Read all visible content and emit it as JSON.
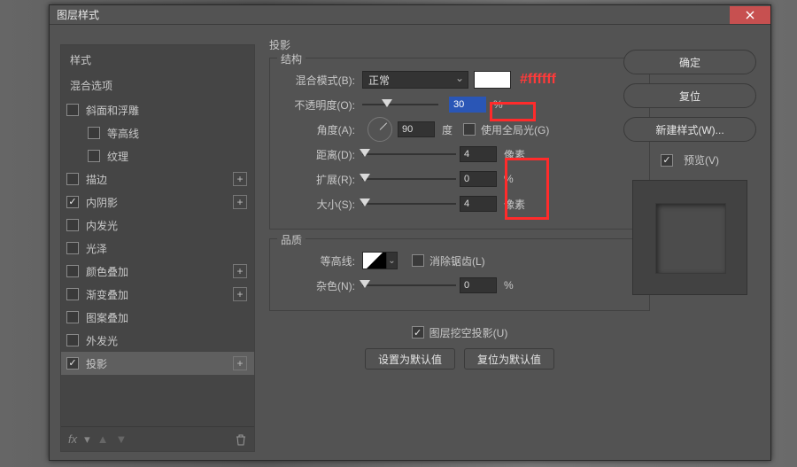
{
  "window": {
    "title": "图层样式"
  },
  "left": {
    "header": "样式",
    "subheader": "混合选项",
    "items": [
      {
        "label": "斜面和浮雕",
        "checked": false,
        "hasPlus": false,
        "indent": false
      },
      {
        "label": "等高线",
        "checked": false,
        "hasPlus": false,
        "indent": true
      },
      {
        "label": "纹理",
        "checked": false,
        "hasPlus": false,
        "indent": true
      },
      {
        "label": "描边",
        "checked": false,
        "hasPlus": true,
        "indent": false
      },
      {
        "label": "内阴影",
        "checked": true,
        "hasPlus": true,
        "indent": false
      },
      {
        "label": "内发光",
        "checked": false,
        "hasPlus": false,
        "indent": false
      },
      {
        "label": "光泽",
        "checked": false,
        "hasPlus": false,
        "indent": false
      },
      {
        "label": "颜色叠加",
        "checked": false,
        "hasPlus": true,
        "indent": false
      },
      {
        "label": "渐变叠加",
        "checked": false,
        "hasPlus": true,
        "indent": false
      },
      {
        "label": "图案叠加",
        "checked": false,
        "hasPlus": false,
        "indent": false
      },
      {
        "label": "外发光",
        "checked": false,
        "hasPlus": false,
        "indent": false
      },
      {
        "label": "投影",
        "checked": true,
        "hasPlus": true,
        "indent": false,
        "selected": true
      }
    ],
    "footer_fx": "fx"
  },
  "mid": {
    "section": "投影",
    "group_structure": "结构",
    "blend_label": "混合模式(B):",
    "blend_value": "正常",
    "annot_color": "#ffffff",
    "opacity_label": "不透明度(O):",
    "opacity_value": "30",
    "opacity_unit": "%",
    "angle_label": "角度(A):",
    "angle_value": "90",
    "angle_unit": "度",
    "global_light_label": "使用全局光(G)",
    "global_light_checked": false,
    "distance_label": "距离(D):",
    "distance_value": "4",
    "distance_unit": "像素",
    "spread_label": "扩展(R):",
    "spread_value": "0",
    "spread_unit": "%",
    "size_label": "大小(S):",
    "size_value": "4",
    "size_unit": "像素",
    "group_quality": "品质",
    "contour_label": "等高线:",
    "antialias_label": "消除锯齿(L)",
    "antialias_checked": false,
    "noise_label": "杂色(N):",
    "noise_value": "0",
    "noise_unit": "%",
    "knockout_label": "图层挖空投影(U)",
    "knockout_checked": true,
    "btn_default": "设置为默认值",
    "btn_reset": "复位为默认值"
  },
  "right": {
    "ok": "确定",
    "cancel": "复位",
    "newstyle": "新建样式(W)...",
    "preview_label": "预览(V)",
    "preview_checked": true
  }
}
